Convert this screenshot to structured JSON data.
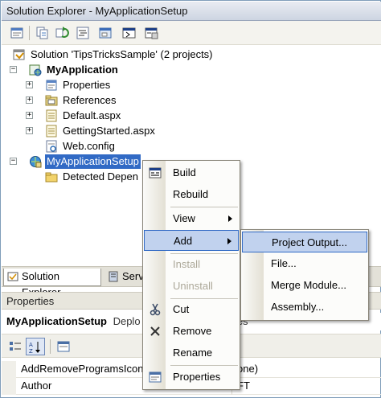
{
  "window": {
    "title": "Solution Explorer - MyApplicationSetup"
  },
  "toolbar": {
    "icons": [
      "properties-icon",
      "show-all-files-icon",
      "refresh-icon",
      "view-code-icon",
      "view-designer-icon",
      "file-system-editor-icon",
      "registry-editor-icon"
    ]
  },
  "tree": {
    "solution": "Solution 'TipsTricksSample' (2 projects)",
    "project": "MyApplication",
    "items": [
      "Properties",
      "References",
      "Default.aspx",
      "GettingStarted.aspx",
      "Web.config"
    ],
    "setup_project": "MyApplicationSetup",
    "setup_child": "Detected Depen"
  },
  "tabs": {
    "solution_explorer": "Solution Explorer",
    "server_explorer": "Serv"
  },
  "properties": {
    "title": "Properties",
    "object_name": "MyApplicationSetup",
    "object_type": "Deplo",
    "object_type_tail": "rties",
    "rows": [
      {
        "name": "AddRemoveProgramsIcon",
        "value": "one)"
      },
      {
        "name": "Author",
        "value": "FT"
      }
    ]
  },
  "context_menu": {
    "build": "Build",
    "rebuild": "Rebuild",
    "view": "View",
    "add": "Add",
    "install": "Install",
    "uninstall": "Uninstall",
    "cut": "Cut",
    "remove": "Remove",
    "rename": "Rename",
    "properties": "Properties"
  },
  "add_submenu": {
    "project_output": "Project Output...",
    "file": "File...",
    "merge_module": "Merge Module...",
    "assembly": "Assembly..."
  },
  "colors": {
    "selection": "#316ac5",
    "menu_highlight": "#c1d2ee"
  }
}
